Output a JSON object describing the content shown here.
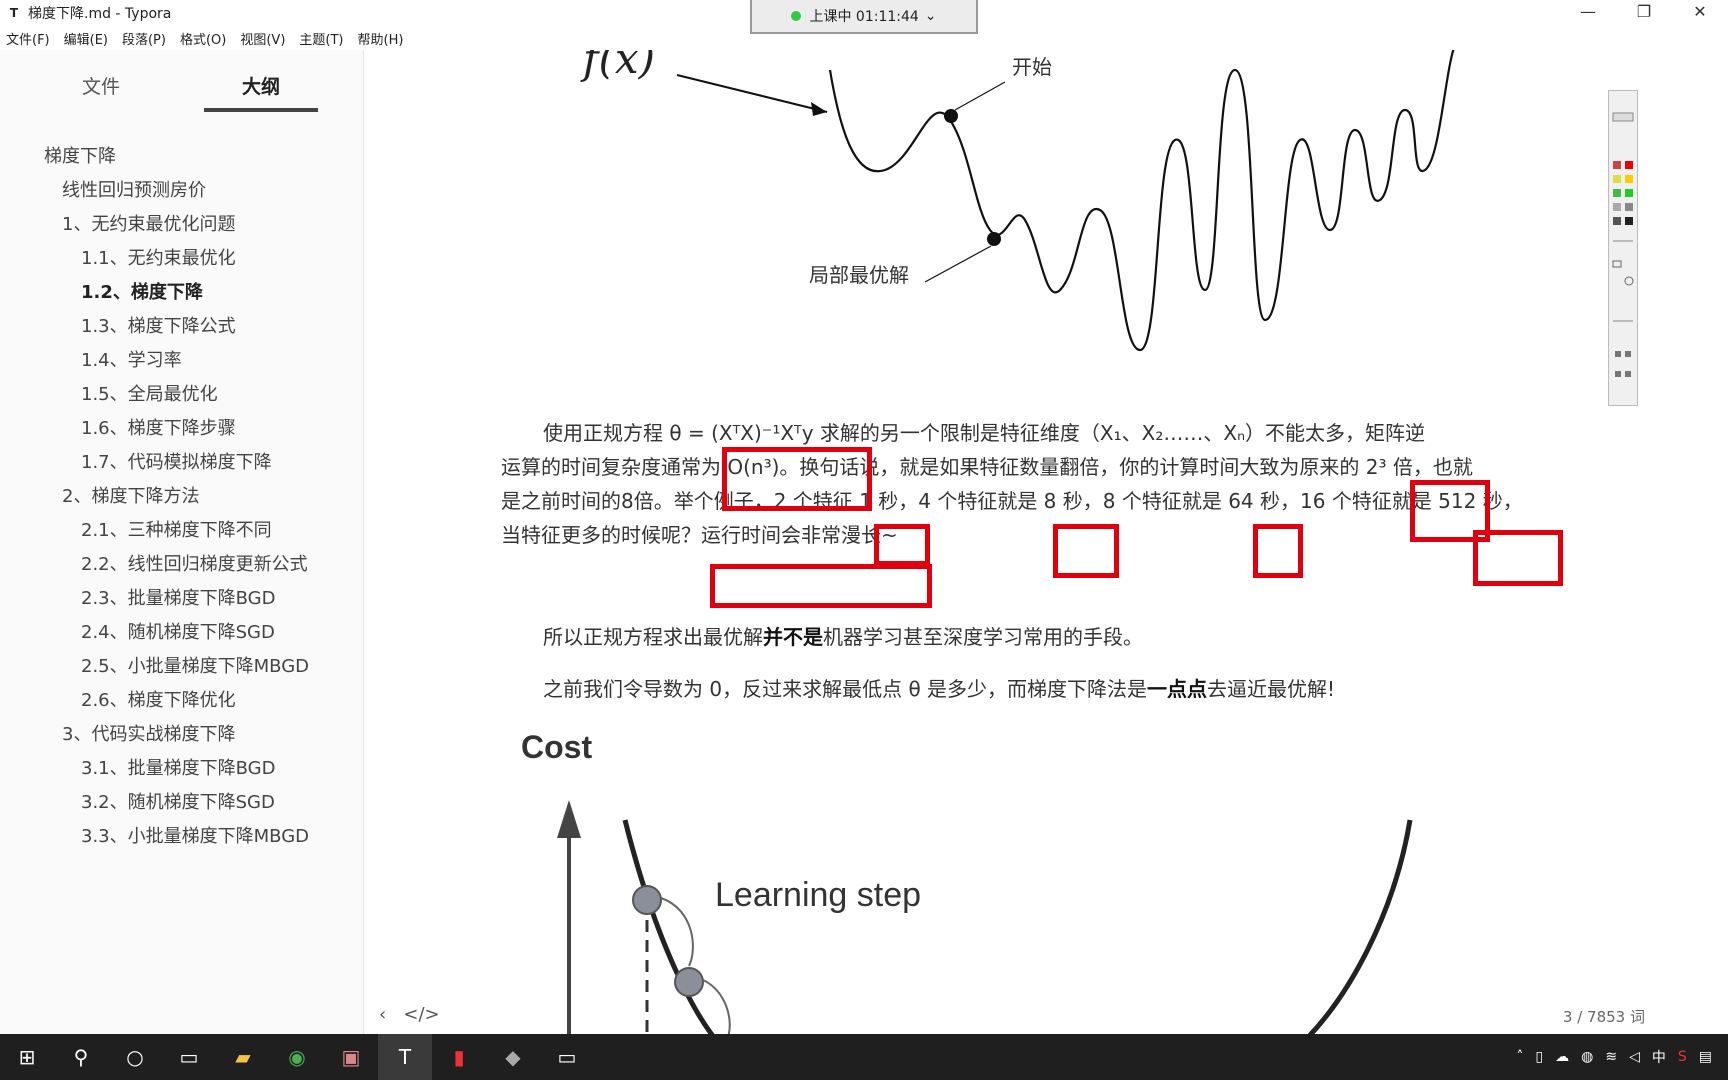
{
  "window": {
    "title": "梯度下降.md - Typora",
    "logo": "T"
  },
  "menu": [
    "文件(F)",
    "编辑(E)",
    "段落(P)",
    "格式(O)",
    "视图(V)",
    "主题(T)",
    "帮助(H)"
  ],
  "class_badge": {
    "text": "上课中 01:11:44",
    "chevron": "⌄"
  },
  "sidebar": {
    "tabs": [
      {
        "label": "文件"
      },
      {
        "label": "大纲",
        "active": true
      }
    ],
    "outline": [
      {
        "label": "梯度下降",
        "level": 1
      },
      {
        "label": "线性回归预测房价",
        "level": 2
      },
      {
        "label": "1、无约束最优化问题",
        "level": 2
      },
      {
        "label": "1.1、无约束最优化",
        "level": 3
      },
      {
        "label": "1.2、梯度下降",
        "level": 3,
        "active": true
      },
      {
        "label": "1.3、梯度下降公式",
        "level": 3
      },
      {
        "label": "1.4、学习率",
        "level": 3
      },
      {
        "label": "1.5、全局最优化",
        "level": 3
      },
      {
        "label": "1.6、梯度下降步骤",
        "level": 3
      },
      {
        "label": "1.7、代码模拟梯度下降",
        "level": 3
      },
      {
        "label": "2、梯度下降方法",
        "level": 2
      },
      {
        "label": "2.1、三种梯度下降不同",
        "level": 3
      },
      {
        "label": "2.2、线性回归梯度更新公式",
        "level": 3
      },
      {
        "label": "2.3、批量梯度下降BGD",
        "level": 3
      },
      {
        "label": "2.4、随机梯度下降SGD",
        "level": 3
      },
      {
        "label": "2.5、小批量梯度下降MBGD",
        "level": 3
      },
      {
        "label": "2.6、梯度下降优化",
        "level": 3
      },
      {
        "label": "3、代码实战梯度下降",
        "level": 2
      },
      {
        "label": "3.1、批量梯度下降BGD",
        "level": 3
      },
      {
        "label": "3.2、随机梯度下降SGD",
        "level": 3
      },
      {
        "label": "3.3、小批量梯度下降MBGD",
        "level": 3
      }
    ]
  },
  "figure1": {
    "fx_label": "f(x)",
    "start_label": "开始",
    "local_label": "局部最优解"
  },
  "paragraph1": {
    "line1a": "使用正规方程 θ = (XᵀX)⁻¹Xᵀy 求解的另一个限制是特征维度（X₁、X₂……、Xₙ）不能太多，矩阵逆",
    "line2": "运算的时间复杂度通常为 O(n³)。换句话说，就是如果特征数量翻倍，你的计算时间大致为原来的 2³ 倍，也就",
    "line3": "是之前时间的8倍。举个例子，2 个特征 1 秒，4 个特征就是 8 秒，8 个特征就是 64 秒，16 个特征就是 512 秒，",
    "line4": "当特征更多的时候呢？运行时间会非常漫长~"
  },
  "paragraph2": {
    "pre": "所以正规方程求出最优解",
    "bold": "并不是",
    "post": "机器学习甚至深度学习常用的手段。"
  },
  "paragraph3": {
    "pre": "之前我们令导数为 0，反过来求解最低点 θ 是多少，而梯度下降法是",
    "bold": "一点点",
    "post": "去逼近最优解!"
  },
  "figure2": {
    "cost_label": "Cost",
    "step_label": "Learning step"
  },
  "status": {
    "word_count": "3 / 7853 词",
    "back": "‹",
    "code_toggle": "</>"
  },
  "taskbar": {
    "time_hidden": ""
  },
  "colors": {
    "annotation_red": "#e0000e",
    "sidebar_bg": "#fafafa",
    "taskbar_bg": "#1f1f1f"
  }
}
